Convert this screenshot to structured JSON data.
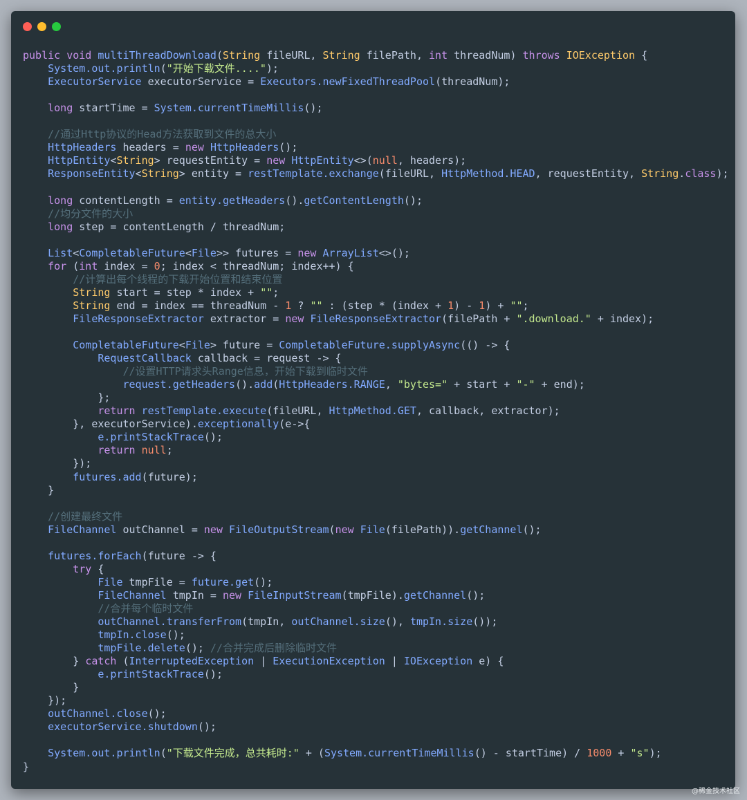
{
  "window": {
    "controls": [
      {
        "name": "close",
        "color": "#ff5f56"
      },
      {
        "name": "minimize",
        "color": "#ffbd2e"
      },
      {
        "name": "maximize",
        "color": "#27c93f"
      }
    ]
  },
  "code_lines": [
    [
      [
        "kw",
        "public"
      ],
      [
        "pl",
        " "
      ],
      [
        "kw",
        "void"
      ],
      [
        "pl",
        " "
      ],
      [
        "fn",
        "multiThreadDownload"
      ],
      [
        "pl",
        "("
      ],
      [
        "ty",
        "String"
      ],
      [
        "pl",
        " fileURL, "
      ],
      [
        "ty",
        "String"
      ],
      [
        "pl",
        " filePath, "
      ],
      [
        "kw",
        "int"
      ],
      [
        "pl",
        " threadNum) "
      ],
      [
        "kw",
        "throws"
      ],
      [
        "pl",
        " "
      ],
      [
        "ty",
        "IOException"
      ],
      [
        "pl",
        " {"
      ]
    ],
    [
      [
        "pl",
        "    "
      ],
      [
        "fn",
        "System.out.println"
      ],
      [
        "pl",
        "("
      ],
      [
        "st",
        "\"开始下载文件....\""
      ],
      [
        "pl",
        ");"
      ]
    ],
    [
      [
        "pl",
        "    "
      ],
      [
        "fn",
        "ExecutorService"
      ],
      [
        "pl",
        " executorService = "
      ],
      [
        "fn",
        "Executors.newFixedThreadPool"
      ],
      [
        "pl",
        "(threadNum);"
      ]
    ],
    [],
    [
      [
        "pl",
        "    "
      ],
      [
        "kw",
        "long"
      ],
      [
        "pl",
        " startTime = "
      ],
      [
        "fn",
        "System.currentTimeMillis"
      ],
      [
        "pl",
        "();"
      ]
    ],
    [],
    [
      [
        "pl",
        "    "
      ],
      [
        "cm",
        "//通过Http协议的Head方法获取到文件的总大小"
      ]
    ],
    [
      [
        "pl",
        "    "
      ],
      [
        "fn",
        "HttpHeaders"
      ],
      [
        "pl",
        " headers = "
      ],
      [
        "kw",
        "new"
      ],
      [
        "pl",
        " "
      ],
      [
        "fn",
        "HttpHeaders"
      ],
      [
        "pl",
        "();"
      ]
    ],
    [
      [
        "pl",
        "    "
      ],
      [
        "fn",
        "HttpEntity"
      ],
      [
        "pl",
        "<"
      ],
      [
        "ty",
        "String"
      ],
      [
        "pl",
        "> requestEntity = "
      ],
      [
        "kw",
        "new"
      ],
      [
        "pl",
        " "
      ],
      [
        "fn",
        "HttpEntity"
      ],
      [
        "pl",
        "<>("
      ],
      [
        "nm",
        "null"
      ],
      [
        "pl",
        ", headers);"
      ]
    ],
    [
      [
        "pl",
        "    "
      ],
      [
        "fn",
        "ResponseEntity"
      ],
      [
        "pl",
        "<"
      ],
      [
        "ty",
        "String"
      ],
      [
        "pl",
        "> entity = "
      ],
      [
        "fn",
        "restTemplate.exchange"
      ],
      [
        "pl",
        "(fileURL, "
      ],
      [
        "fn",
        "HttpMethod.HEAD"
      ],
      [
        "pl",
        ", requestEntity, "
      ],
      [
        "ty",
        "String"
      ],
      [
        "pl",
        "."
      ],
      [
        "kw",
        "class"
      ],
      [
        "pl",
        ");"
      ]
    ],
    [],
    [
      [
        "pl",
        "    "
      ],
      [
        "kw",
        "long"
      ],
      [
        "pl",
        " contentLength = "
      ],
      [
        "fn",
        "entity.getHeaders"
      ],
      [
        "pl",
        "()."
      ],
      [
        "fn",
        "getContentLength"
      ],
      [
        "pl",
        "();"
      ]
    ],
    [
      [
        "pl",
        "    "
      ],
      [
        "cm",
        "//均分文件的大小"
      ]
    ],
    [
      [
        "pl",
        "    "
      ],
      [
        "kw",
        "long"
      ],
      [
        "pl",
        " step = contentLength / threadNum;"
      ]
    ],
    [],
    [
      [
        "pl",
        "    "
      ],
      [
        "fn",
        "List"
      ],
      [
        "pl",
        "<"
      ],
      [
        "fn",
        "CompletableFuture"
      ],
      [
        "pl",
        "<"
      ],
      [
        "fn",
        "File"
      ],
      [
        "pl",
        ">> futures = "
      ],
      [
        "kw",
        "new"
      ],
      [
        "pl",
        " "
      ],
      [
        "fn",
        "ArrayList"
      ],
      [
        "pl",
        "<>();"
      ]
    ],
    [
      [
        "pl",
        "    "
      ],
      [
        "kw",
        "for"
      ],
      [
        "pl",
        " ("
      ],
      [
        "kw",
        "int"
      ],
      [
        "pl",
        " index = "
      ],
      [
        "nm",
        "0"
      ],
      [
        "pl",
        "; index < threadNum; index++) {"
      ]
    ],
    [
      [
        "pl",
        "        "
      ],
      [
        "cm",
        "//计算出每个线程的下载开始位置和结束位置"
      ]
    ],
    [
      [
        "pl",
        "        "
      ],
      [
        "ty",
        "String"
      ],
      [
        "pl",
        " start = step * index + "
      ],
      [
        "st",
        "\"\""
      ],
      [
        "pl",
        ";"
      ]
    ],
    [
      [
        "pl",
        "        "
      ],
      [
        "ty",
        "String"
      ],
      [
        "pl",
        " end = index == threadNum - "
      ],
      [
        "nm",
        "1"
      ],
      [
        "pl",
        " ? "
      ],
      [
        "st",
        "\"\""
      ],
      [
        "pl",
        " : (step * (index + "
      ],
      [
        "nm",
        "1"
      ],
      [
        "pl",
        ") - "
      ],
      [
        "nm",
        "1"
      ],
      [
        "pl",
        ") + "
      ],
      [
        "st",
        "\"\""
      ],
      [
        "pl",
        ";"
      ]
    ],
    [
      [
        "pl",
        "        "
      ],
      [
        "fn",
        "FileResponseExtractor"
      ],
      [
        "pl",
        " extractor = "
      ],
      [
        "kw",
        "new"
      ],
      [
        "pl",
        " "
      ],
      [
        "fn",
        "FileResponseExtractor"
      ],
      [
        "pl",
        "(filePath + "
      ],
      [
        "st",
        "\".download.\""
      ],
      [
        "pl",
        " + index);"
      ]
    ],
    [],
    [
      [
        "pl",
        "        "
      ],
      [
        "fn",
        "CompletableFuture"
      ],
      [
        "pl",
        "<"
      ],
      [
        "fn",
        "File"
      ],
      [
        "pl",
        "> future = "
      ],
      [
        "fn",
        "CompletableFuture.supplyAsync"
      ],
      [
        "pl",
        "(() -> {"
      ]
    ],
    [
      [
        "pl",
        "            "
      ],
      [
        "fn",
        "RequestCallback"
      ],
      [
        "pl",
        " callback = request -> {"
      ]
    ],
    [
      [
        "pl",
        "                "
      ],
      [
        "cm",
        "//设置HTTP请求头Range信息，开始下载到临时文件"
      ]
    ],
    [
      [
        "pl",
        "                "
      ],
      [
        "fn",
        "request.getHeaders"
      ],
      [
        "pl",
        "()."
      ],
      [
        "fn",
        "add"
      ],
      [
        "pl",
        "("
      ],
      [
        "fn",
        "HttpHeaders.RANGE"
      ],
      [
        "pl",
        ", "
      ],
      [
        "st",
        "\"bytes=\""
      ],
      [
        "pl",
        " + start + "
      ],
      [
        "st",
        "\"-\""
      ],
      [
        "pl",
        " + end);"
      ]
    ],
    [
      [
        "pl",
        "            };"
      ]
    ],
    [
      [
        "pl",
        "            "
      ],
      [
        "kw",
        "return"
      ],
      [
        "pl",
        " "
      ],
      [
        "fn",
        "restTemplate.execute"
      ],
      [
        "pl",
        "(fileURL, "
      ],
      [
        "fn",
        "HttpMethod.GET"
      ],
      [
        "pl",
        ", callback, extractor);"
      ]
    ],
    [
      [
        "pl",
        "        }, executorService)."
      ],
      [
        "fn",
        "exceptionally"
      ],
      [
        "pl",
        "(e->{"
      ]
    ],
    [
      [
        "pl",
        "            "
      ],
      [
        "fn",
        "e.printStackTrace"
      ],
      [
        "pl",
        "();"
      ]
    ],
    [
      [
        "pl",
        "            "
      ],
      [
        "kw",
        "return"
      ],
      [
        "pl",
        " "
      ],
      [
        "nm",
        "null"
      ],
      [
        "pl",
        ";"
      ]
    ],
    [
      [
        "pl",
        "        });"
      ]
    ],
    [
      [
        "pl",
        "        "
      ],
      [
        "fn",
        "futures.add"
      ],
      [
        "pl",
        "(future);"
      ]
    ],
    [
      [
        "pl",
        "    }"
      ]
    ],
    [],
    [
      [
        "pl",
        "    "
      ],
      [
        "cm",
        "//创建最终文件"
      ]
    ],
    [
      [
        "pl",
        "    "
      ],
      [
        "fn",
        "FileChannel"
      ],
      [
        "pl",
        " outChannel = "
      ],
      [
        "kw",
        "new"
      ],
      [
        "pl",
        " "
      ],
      [
        "fn",
        "FileOutputStream"
      ],
      [
        "pl",
        "("
      ],
      [
        "kw",
        "new"
      ],
      [
        "pl",
        " "
      ],
      [
        "fn",
        "File"
      ],
      [
        "pl",
        "(filePath))."
      ],
      [
        "fn",
        "getChannel"
      ],
      [
        "pl",
        "();"
      ]
    ],
    [],
    [
      [
        "pl",
        "    "
      ],
      [
        "fn",
        "futures.forEach"
      ],
      [
        "pl",
        "(future -> {"
      ]
    ],
    [
      [
        "pl",
        "        "
      ],
      [
        "kw",
        "try"
      ],
      [
        "pl",
        " {"
      ]
    ],
    [
      [
        "pl",
        "            "
      ],
      [
        "fn",
        "File"
      ],
      [
        "pl",
        " tmpFile = "
      ],
      [
        "fn",
        "future.get"
      ],
      [
        "pl",
        "();"
      ]
    ],
    [
      [
        "pl",
        "            "
      ],
      [
        "fn",
        "FileChannel"
      ],
      [
        "pl",
        " tmpIn = "
      ],
      [
        "kw",
        "new"
      ],
      [
        "pl",
        " "
      ],
      [
        "fn",
        "FileInputStream"
      ],
      [
        "pl",
        "(tmpFile)."
      ],
      [
        "fn",
        "getChannel"
      ],
      [
        "pl",
        "();"
      ]
    ],
    [
      [
        "pl",
        "            "
      ],
      [
        "cm",
        "//合并每个临时文件"
      ]
    ],
    [
      [
        "pl",
        "            "
      ],
      [
        "fn",
        "outChannel.transferFrom"
      ],
      [
        "pl",
        "(tmpIn, "
      ],
      [
        "fn",
        "outChannel.size"
      ],
      [
        "pl",
        "(), "
      ],
      [
        "fn",
        "tmpIn.size"
      ],
      [
        "pl",
        "());"
      ]
    ],
    [
      [
        "pl",
        "            "
      ],
      [
        "fn",
        "tmpIn.close"
      ],
      [
        "pl",
        "();"
      ]
    ],
    [
      [
        "pl",
        "            "
      ],
      [
        "fn",
        "tmpFile.delete"
      ],
      [
        "pl",
        "(); "
      ],
      [
        "cm",
        "//合并完成后删除临时文件"
      ]
    ],
    [
      [
        "pl",
        "        } "
      ],
      [
        "kw",
        "catch"
      ],
      [
        "pl",
        " ("
      ],
      [
        "fn",
        "InterruptedException"
      ],
      [
        "pl",
        " | "
      ],
      [
        "fn",
        "ExecutionException"
      ],
      [
        "pl",
        " | "
      ],
      [
        "fn",
        "IOException"
      ],
      [
        "pl",
        " e) {"
      ]
    ],
    [
      [
        "pl",
        "            "
      ],
      [
        "fn",
        "e.printStackTrace"
      ],
      [
        "pl",
        "();"
      ]
    ],
    [
      [
        "pl",
        "        }"
      ]
    ],
    [
      [
        "pl",
        "    });"
      ]
    ],
    [
      [
        "pl",
        "    "
      ],
      [
        "fn",
        "outChannel.close"
      ],
      [
        "pl",
        "();"
      ]
    ],
    [
      [
        "pl",
        "    "
      ],
      [
        "fn",
        "executorService.shutdown"
      ],
      [
        "pl",
        "();"
      ]
    ],
    [],
    [
      [
        "pl",
        "    "
      ],
      [
        "fn",
        "System.out.println"
      ],
      [
        "pl",
        "("
      ],
      [
        "st",
        "\"下载文件完成，总共耗时:\""
      ],
      [
        "pl",
        " + ("
      ],
      [
        "fn",
        "System.currentTimeMillis"
      ],
      [
        "pl",
        "() - startTime) / "
      ],
      [
        "nm",
        "1000"
      ],
      [
        "pl",
        " + "
      ],
      [
        "st",
        "\"s\""
      ],
      [
        "pl",
        ");"
      ]
    ],
    [
      [
        "pl",
        "}"
      ]
    ]
  ],
  "watermark": "@稀金技术社区"
}
